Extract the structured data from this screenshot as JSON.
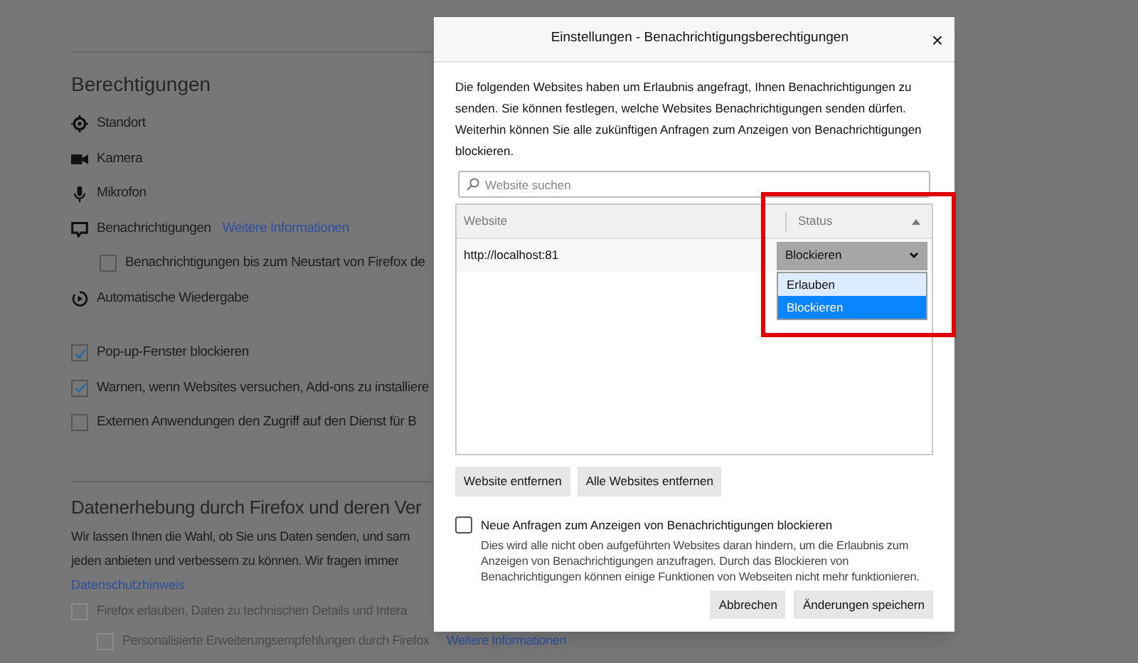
{
  "page": {
    "permissions_heading": "Berechtigungen",
    "permissions": [
      {
        "kind": "location",
        "label": "Standort"
      },
      {
        "kind": "camera",
        "label": "Kamera"
      },
      {
        "kind": "microphone",
        "label": "Mikrofon"
      },
      {
        "kind": "notification",
        "label": "Benachrichtigungen",
        "link": "Weitere Informationen"
      },
      {
        "kind": "subcheck",
        "label": "Benachrichtigungen bis zum Neustart von Firefox de",
        "checked": false
      },
      {
        "kind": "autoplay",
        "label": "Automatische Wiedergabe"
      },
      {
        "kind": "check",
        "label": "Pop-up-Fenster blockieren",
        "checked": true
      },
      {
        "kind": "check",
        "label": "Warnen, wenn Websites versuchen, Add-ons zu installiere",
        "checked": true
      },
      {
        "kind": "check",
        "label": "Externen Anwendungen den Zugriff auf den Dienst für B",
        "checked": false
      }
    ],
    "data_heading": "Datenerhebung durch Firefox und deren Ver",
    "data_text_lines": [
      "Wir lassen Ihnen die Wahl, ob Sie uns Daten senden, und sam",
      "jeden anbieten und verbessern zu können. Wir fragen immer"
    ],
    "privacy_link": "Datenschutzhinweis",
    "data_options": [
      {
        "label": "Firefox erlauben, Daten zu technischen Details und Intera",
        "checked": false,
        "disabled": true
      },
      {
        "label": "Personalisierte Erweiterungsempfehlungen durch Firefox",
        "checked": false,
        "disabled": true,
        "link": "Weitere Informationen"
      }
    ]
  },
  "dialog": {
    "title": "Einstellungen - Benachrichtigungsberechtigungen",
    "close": "×",
    "intro": "Die folgenden Websites haben um Erlaubnis angefragt, Ihnen Benachrichtigungen zu senden. Sie können festlegen, welche Websites Benachrichtigungen senden dürfen. Weiterhin können Sie alle zukünftigen Anfragen zum Anzeigen von Benachrichtigungen blockieren.",
    "search": {
      "placeholder": "Website suchen"
    },
    "table": {
      "columns": [
        "Website",
        "Status"
      ],
      "rows": [
        {
          "website": "http://localhost:81",
          "status": "Blockieren"
        }
      ],
      "dropdown": {
        "options": [
          {
            "label": "Erlauben",
            "selected": false,
            "hovered": true
          },
          {
            "label": "Blockieren",
            "selected": true
          }
        ]
      }
    },
    "buttons": [
      "Website entfernen",
      "Alle Websites entfernen"
    ],
    "block_new": {
      "label": "Neue Anfragen zum Anzeigen von Benachrichtigungen blockieren",
      "checked": false,
      "description": "Dies wird alle nicht oben aufgeführten Websites daran hindern, um die Erlaubnis zum Anzeigen von Benachrichtigungen anzufragen. Durch das Blockieren von Benachrichtigungen können einige Funktionen von Webseiten nicht mehr funktionieren."
    },
    "footer_buttons": [
      "Abbrechen",
      "Änderungen speichern"
    ]
  }
}
